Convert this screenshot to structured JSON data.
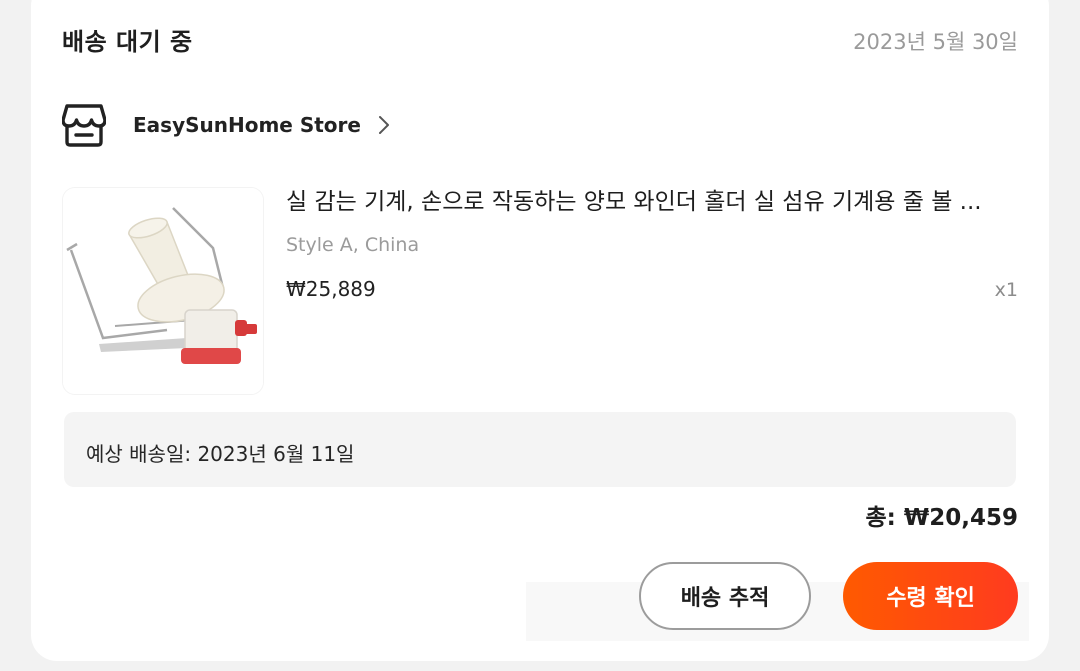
{
  "order": {
    "status": "배송 대기 중",
    "date": "2023년 5월 30일"
  },
  "store": {
    "icon": "store-icon",
    "name": "EasySunHome Store",
    "chevron_icon": "chevron-right-icon"
  },
  "product": {
    "image_icon": "yarn-winder-image",
    "title": "실 감는 기계, 손으로 작동하는 양모 와인더 홀더 실 섬유 기계용 줄 볼 ...",
    "variant": "Style A, China",
    "price": "₩25,889",
    "quantity": "x1"
  },
  "delivery": {
    "estimate": "예상 배송일: 2023년 6월 11일"
  },
  "total": "총: ₩20,459",
  "actions": {
    "track_label": "배송 추적",
    "confirm_label": "수령 확인"
  },
  "colors": {
    "accent": "#ff4a12",
    "page_bg": "#f2f2f2"
  }
}
